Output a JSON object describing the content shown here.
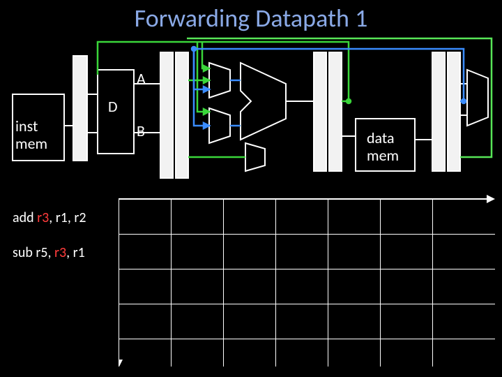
{
  "title": "Forwarding Datapath 1",
  "labels": {
    "inst_mem": "inst\nmem",
    "data_mem": "data\nmem",
    "D": "D",
    "A": "A",
    "B": "B"
  },
  "instructions": {
    "add": {
      "op": "add ",
      "dst": "r3",
      "rest": ", r1, r2"
    },
    "sub": {
      "op": "sub r5, ",
      "src": "r3",
      "rest": ", r1"
    }
  },
  "colors": {
    "forward_a": "#3ad63a",
    "forward_b": "#3a8cff",
    "mem_forward": "#57e557"
  }
}
